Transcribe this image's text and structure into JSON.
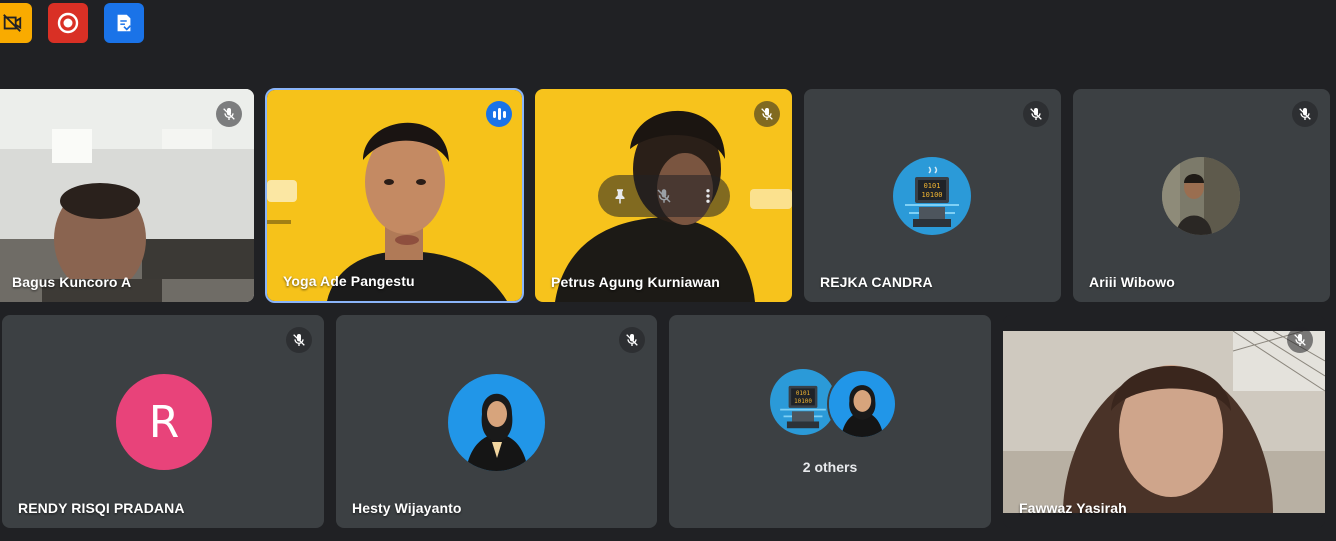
{
  "toolbar": {
    "buttons": [
      {
        "icon": "camera-off-icon",
        "color": "#f9ab00"
      },
      {
        "icon": "record-icon",
        "color": "#d93025"
      },
      {
        "icon": "notes-icon",
        "color": "#1a73e8"
      }
    ]
  },
  "colors": {
    "background": "#202124",
    "tile": "#3c4043",
    "accent": "#1a73e8",
    "avatar_pink": "#e8437a"
  },
  "participants": [
    {
      "name": "Bagus Kuncoro A",
      "muted": true,
      "video": true
    },
    {
      "name": "Yoga Ade Pangestu",
      "muted": false,
      "speaking": true,
      "video": true
    },
    {
      "name": "Petrus Agung Kurniawan",
      "muted": true,
      "video": true
    },
    {
      "name": "REJKA CANDRA",
      "muted": true,
      "video": false
    },
    {
      "name": "Ariii Wibowo",
      "muted": true,
      "video": false
    },
    {
      "name": "RENDY RISQI PRADANA",
      "muted": true,
      "video": false,
      "initial": "R"
    },
    {
      "name": "Hesty Wijayanto",
      "muted": true,
      "video": false
    },
    {
      "name": "2 others",
      "video": false
    },
    {
      "name": "Fawwaz Yasirah",
      "muted": true,
      "video": true
    }
  ]
}
